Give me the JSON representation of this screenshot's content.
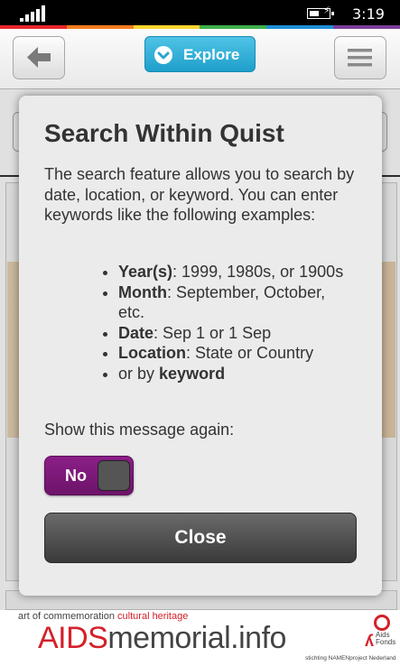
{
  "status_bar": {
    "time": "3:19"
  },
  "rainbow_colors": [
    "#e8262b",
    "#f47d20",
    "#fcd52f",
    "#3fae49",
    "#1e8fd6",
    "#7b3f98"
  ],
  "app_bar": {
    "back_icon": "arrow-left-icon",
    "explore_label": "Explore",
    "explore_icon": "chevron-down-icon",
    "menu_icon": "hamburger-menu-icon"
  },
  "dialog": {
    "title": "Search Within Quist",
    "intro": "The search feature allows you to search by date, location, or keyword. You can enter keywords like the following examples:",
    "examples": [
      {
        "term": "Year(s)",
        "rest": ": 1999, 1980s, or 1900s"
      },
      {
        "term": "Month",
        "rest": ": September, October, etc."
      },
      {
        "term": "Date",
        "rest": ": Sep 1 or 1 Sep"
      },
      {
        "term": "Location",
        "rest": ": State or Country"
      },
      {
        "prefix": "or by ",
        "term": "keyword"
      }
    ],
    "show_again_label": "Show this message again:",
    "toggle_label": "No",
    "toggle_on": false,
    "close_label": "Close"
  },
  "footer": {
    "tagline_left": "art of commemoration",
    "tagline_right": "cultural heritage",
    "logo_red": "AIDS",
    "logo_dark": "memorial.info",
    "sponsor_line1": "Aids",
    "sponsor_line2": "Fonds",
    "stichting": "stichting NAMENproject Nederland",
    "brand_red": "#d4202a"
  }
}
